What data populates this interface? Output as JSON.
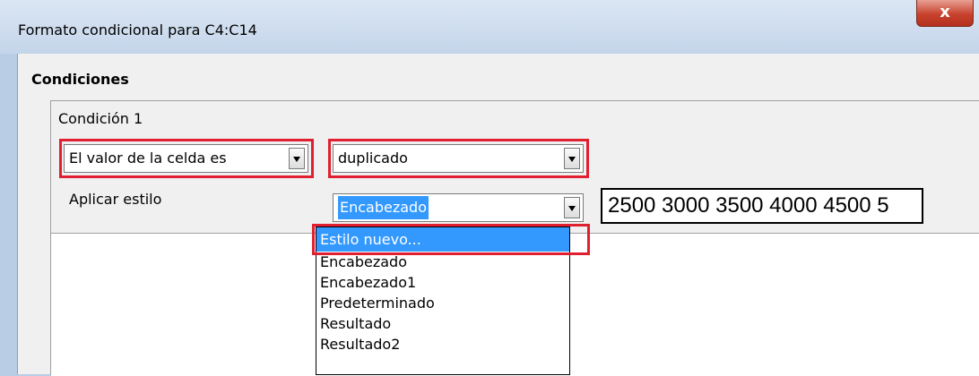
{
  "window": {
    "title": "Formato condicional para C4:C14",
    "close_glyph": "x"
  },
  "section": {
    "title": "Condiciones"
  },
  "condition": {
    "label": "Condición 1",
    "type_select_value": "El valor de la celda es",
    "operator_select_value": "duplicado",
    "apply_style_label": "Aplicar estilo",
    "style_select_value": "Encabezado",
    "preview_text": "2500 3000 3500 4000 4500 5"
  },
  "style_options": [
    "Estilo nuevo...",
    "Encabezado",
    "Encabezado1",
    "Predeterminado",
    "Resultado",
    "Resultado2"
  ],
  "colors": {
    "highlight": "#e02030",
    "selection": "#3399ff"
  }
}
